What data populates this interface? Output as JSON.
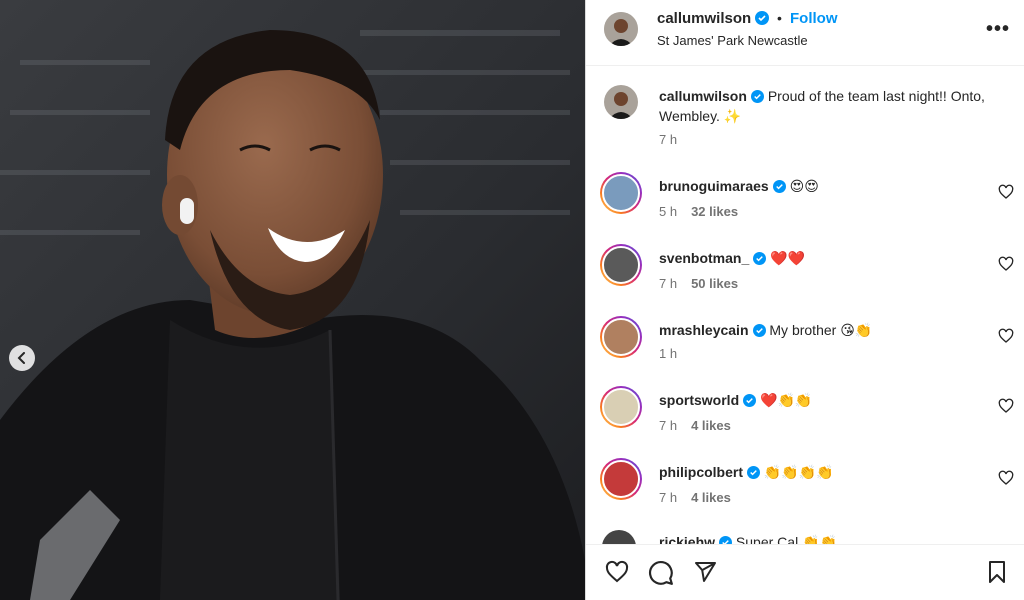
{
  "post": {
    "author": "callumwilson",
    "follow_label": "Follow",
    "location": "St James' Park Newcastle",
    "more_label": "•••",
    "caption_text": "Proud of the team last night!! Onto, Wembley. ✨",
    "caption_time": "7 h"
  },
  "comments": [
    {
      "user": "brunoguimaraes",
      "text": "😍😍",
      "time": "5 h",
      "likes": "32 likes"
    },
    {
      "user": "svenbotman_",
      "text": "❤️❤️",
      "time": "7 h",
      "likes": "50 likes"
    },
    {
      "user": "mrashleycain",
      "text": "My brother 😘👏",
      "time": "1 h",
      "likes": ""
    },
    {
      "user": "sportsworld",
      "text": "❤️👏👏",
      "time": "7 h",
      "likes": "4 likes"
    },
    {
      "user": "philipcolbert",
      "text": "👏👏👏👏",
      "time": "7 h",
      "likes": "4 likes"
    },
    {
      "user": "rickiehw",
      "text": "Super Cal 👏👏",
      "time": "",
      "likes": ""
    }
  ],
  "colors": {
    "accent": "#0095f6",
    "verified": "#0095f6",
    "text": "#262626",
    "muted": "#737373"
  },
  "icons": [
    "chevron-left-icon",
    "verified-badge-icon",
    "more-icon",
    "heart-icon",
    "comment-icon",
    "share-icon",
    "bookmark-icon"
  ]
}
